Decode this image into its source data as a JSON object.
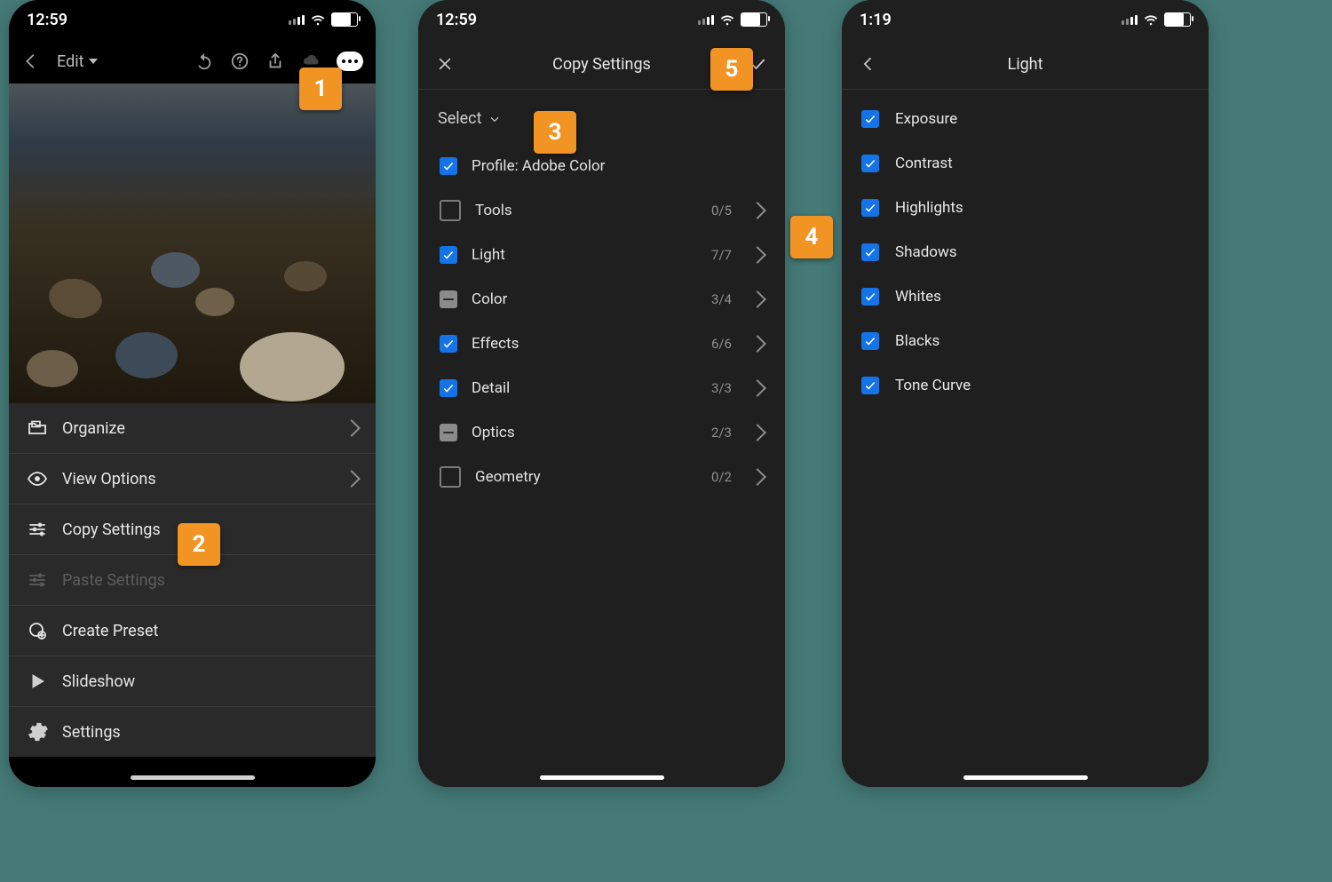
{
  "badges": {
    "b1": "1",
    "b2": "2",
    "b3": "3",
    "b4": "4",
    "b5": "5"
  },
  "p1": {
    "time": "12:59",
    "edit_label": "Edit",
    "menu": {
      "organize": "Organize",
      "view_options": "View Options",
      "copy_settings": "Copy Settings",
      "paste_settings": "Paste Settings",
      "create_preset": "Create Preset",
      "slideshow": "Slideshow",
      "settings": "Settings"
    }
  },
  "p2": {
    "time": "12:59",
    "title": "Copy Settings",
    "select_label": "Select",
    "items": {
      "profile": "Profile: Adobe Color",
      "tools": "Tools",
      "light": "Light",
      "color": "Color",
      "effects": "Effects",
      "detail": "Detail",
      "optics": "Optics",
      "geometry": "Geometry"
    },
    "counts": {
      "tools": "0/5",
      "light": "7/7",
      "color": "3/4",
      "effects": "6/6",
      "detail": "3/3",
      "optics": "2/3",
      "geometry": "0/2"
    }
  },
  "p3": {
    "time": "1:19",
    "title": "Light",
    "items": {
      "exposure": "Exposure",
      "contrast": "Contrast",
      "highlights": "Highlights",
      "shadows": "Shadows",
      "whites": "Whites",
      "blacks": "Blacks",
      "tone_curve": "Tone Curve"
    }
  }
}
